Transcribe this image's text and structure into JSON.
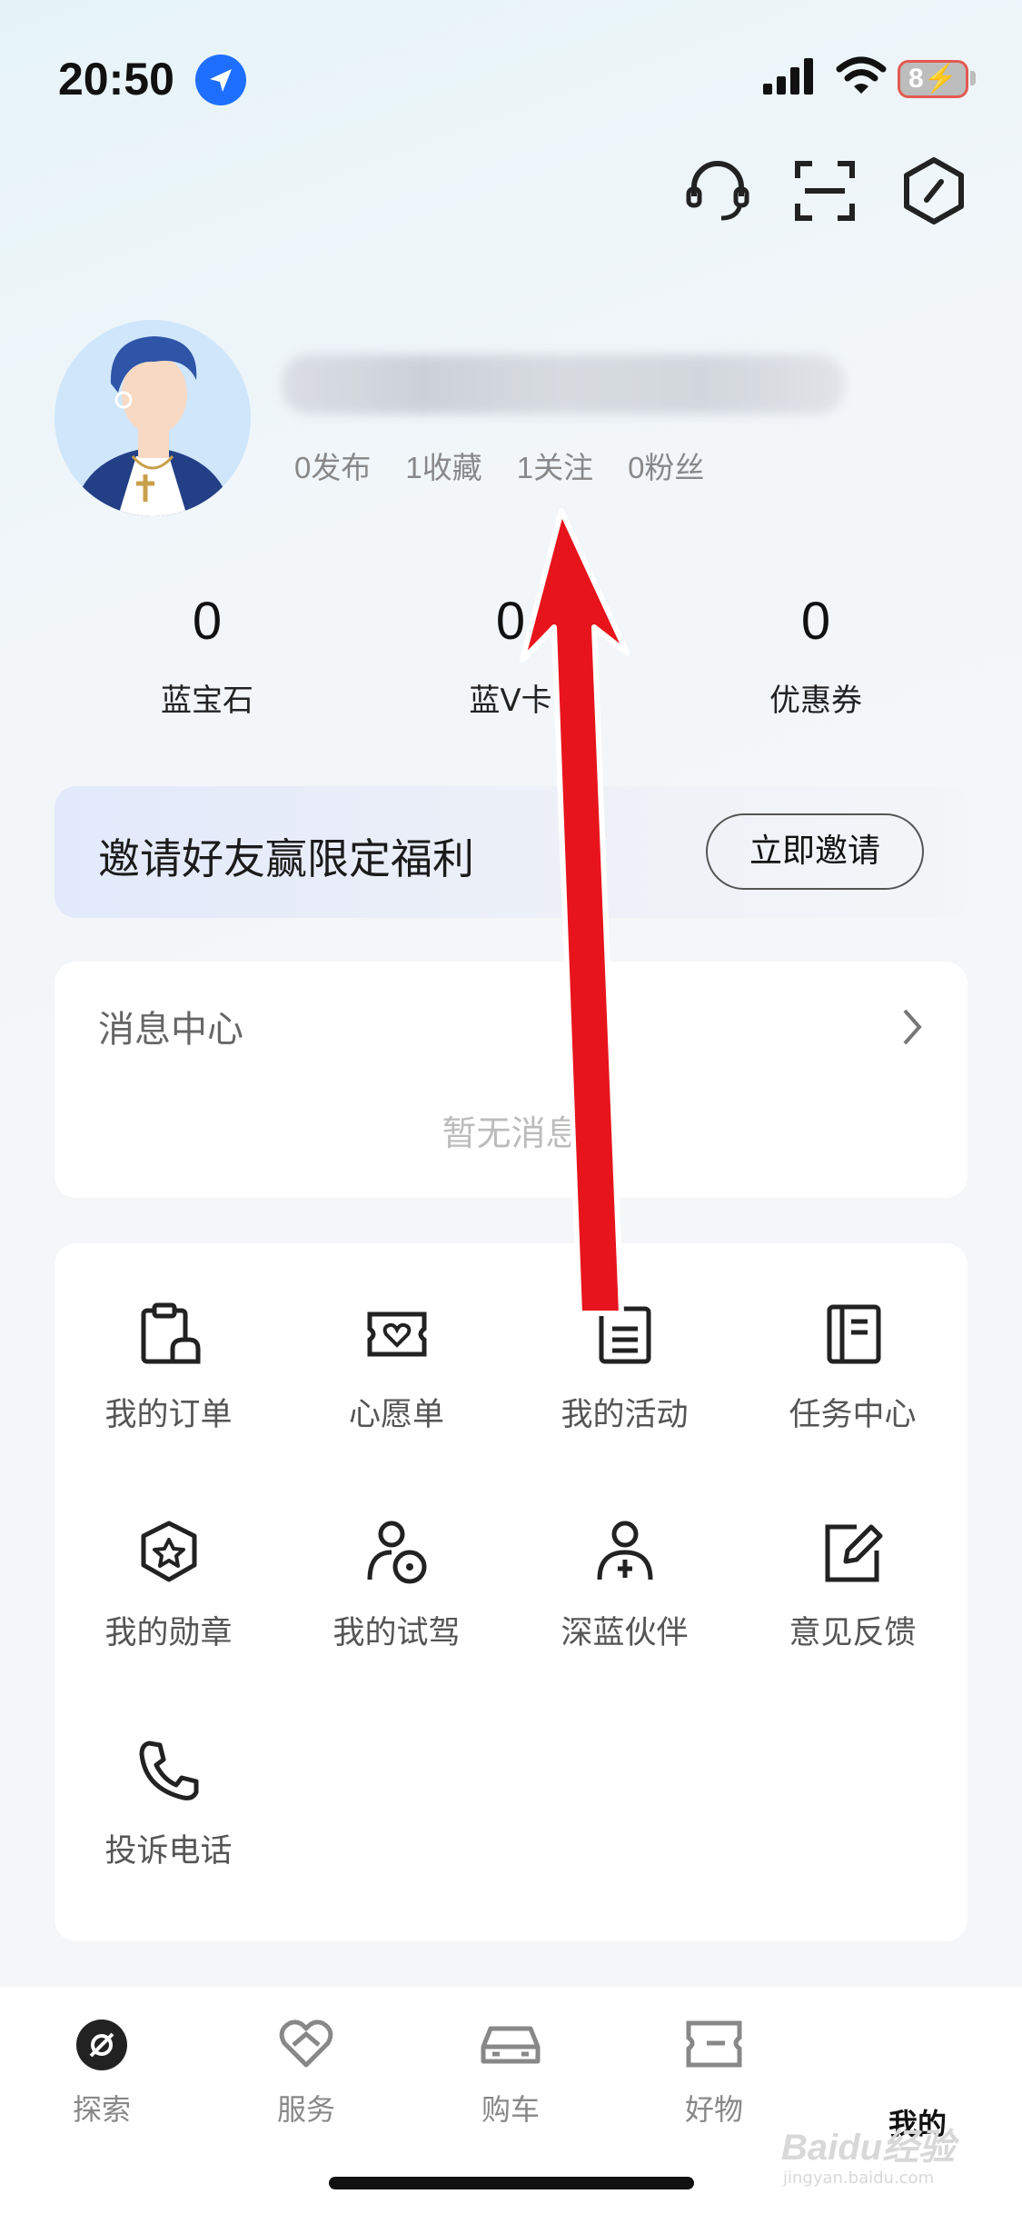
{
  "status_bar": {
    "time": "20:50",
    "battery": "8"
  },
  "profile": {
    "stats": [
      {
        "label": "0发布"
      },
      {
        "label": "1收藏"
      },
      {
        "label": "1关注"
      },
      {
        "label": "0粉丝"
      }
    ]
  },
  "assets": [
    {
      "value": "0",
      "label": "蓝宝石"
    },
    {
      "value": "0",
      "label": "蓝V卡"
    },
    {
      "value": "0",
      "label": "优惠券"
    }
  ],
  "invite": {
    "text": "邀请好友赢限定福利",
    "button": "立即邀请"
  },
  "messages": {
    "title": "消息中心",
    "empty": "暂无消息"
  },
  "services": [
    {
      "label": "我的订单",
      "icon": "order-icon"
    },
    {
      "label": "心愿单",
      "icon": "wishlist-icon"
    },
    {
      "label": "我的活动",
      "icon": "activity-icon"
    },
    {
      "label": "任务中心",
      "icon": "task-icon"
    },
    {
      "label": "我的勋章",
      "icon": "medal-icon"
    },
    {
      "label": "我的试驾",
      "icon": "test-drive-icon"
    },
    {
      "label": "深蓝伙伴",
      "icon": "partner-icon"
    },
    {
      "label": "意见反馈",
      "icon": "feedback-icon"
    },
    {
      "label": "投诉电话",
      "icon": "phone-icon"
    }
  ],
  "tabs": [
    {
      "label": "探索",
      "icon": "explore-icon"
    },
    {
      "label": "服务",
      "icon": "service-icon"
    },
    {
      "label": "购车",
      "icon": "car-icon"
    },
    {
      "label": "好物",
      "icon": "goods-icon"
    },
    {
      "label": "我的",
      "active": true
    }
  ],
  "watermark": {
    "brand": "Baidu经验",
    "url": "jingyan.baidu.com"
  },
  "colors": {
    "accent_blue": "#1e6fff",
    "annotation_red": "#e8141b"
  }
}
